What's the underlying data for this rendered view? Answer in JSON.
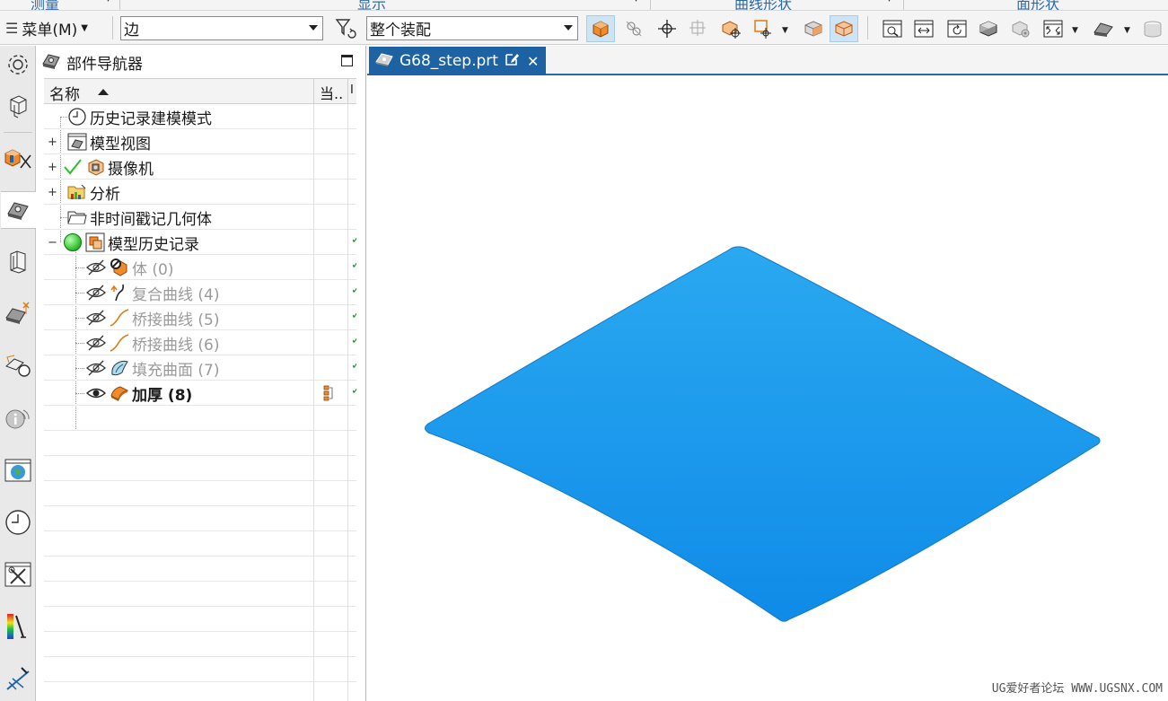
{
  "group_strip": {
    "groups": [
      "测量",
      "显示",
      "曲线形状",
      "面形状"
    ]
  },
  "toolbar": {
    "menu_label": "菜单(M)",
    "selection_filter": "边",
    "selection_scope": "整个装配",
    "icons": [
      "cube-snap-icon",
      "point-on-curve-icon",
      "crosshair-icon",
      "face-snap-icon",
      "box-select-icon",
      "rect-select-icon",
      "shaded-box-icon",
      "wire-box-icon",
      "fit-view-icon",
      "pan-view-icon",
      "rotate-view-icon",
      "shaded-solid-icon",
      "wireframe-solid-icon",
      "zoom-fit-icon",
      "render-style-icon",
      "cylinder-icon"
    ]
  },
  "resource_bar": {
    "items": [
      "settings-icon",
      "assembly-icon",
      "constraints-icon",
      "part-navigator-icon",
      "reuse-library-icon",
      "hd3d-icon",
      "web-browser-icon",
      "history-icon",
      "process-studio-icon",
      "analysis-icon",
      "roles-icon",
      "system-scenes-icon"
    ]
  },
  "navigator": {
    "title": "部件导航器",
    "columns": {
      "name": "名称",
      "current": "当..",
      "last": "I"
    },
    "rows": [
      {
        "label": "历史记录建模模式",
        "icon": "clock-icon",
        "expand": "",
        "check": false,
        "dim": false,
        "bold": false
      },
      {
        "label": "模型视图",
        "icon": "model-views-icon",
        "expand": "+",
        "check": false,
        "dim": false,
        "bold": false
      },
      {
        "label": "摄像机",
        "icon": "camera-icon",
        "expand": "+",
        "check": true,
        "dim": false,
        "bold": false
      },
      {
        "label": "分析",
        "icon": "analysis-folder-icon",
        "expand": "+",
        "check": false,
        "dim": false,
        "bold": false
      },
      {
        "label": "非时间戳记几何体",
        "icon": "folder-icon",
        "expand": "",
        "check": false,
        "dim": false,
        "bold": false
      },
      {
        "label": "模型历史记录",
        "icon": "model-history-icon",
        "expand": "−",
        "check": false,
        "dim": false,
        "bold": false
      },
      {
        "label": "体 (0)",
        "icon": "body-icon",
        "expand": "",
        "check": false,
        "dim": true,
        "bold": false
      },
      {
        "label": "复合曲线 (4)",
        "icon": "composite-curve-icon",
        "expand": "",
        "check": false,
        "dim": true,
        "bold": false
      },
      {
        "label": "桥接曲线 (5)",
        "icon": "bridge-curve-icon",
        "expand": "",
        "check": false,
        "dim": true,
        "bold": false
      },
      {
        "label": "桥接曲线 (6)",
        "icon": "bridge-curve-icon",
        "expand": "",
        "check": false,
        "dim": true,
        "bold": false
      },
      {
        "label": "填充曲面 (7)",
        "icon": "fill-surface-icon",
        "expand": "",
        "check": false,
        "dim": true,
        "bold": false
      },
      {
        "label": "加厚 (8)",
        "icon": "thicken-icon",
        "expand": "",
        "check": false,
        "dim": false,
        "bold": true
      }
    ]
  },
  "graphics": {
    "tab_label": "G68_step.prt",
    "watermark": "UG爱好者论坛 WWW.UGSNX.COM",
    "colors": {
      "surface_top": "#2aa9f0",
      "surface_bottom": "#0f8be8",
      "accent": "#1d63a3"
    }
  }
}
